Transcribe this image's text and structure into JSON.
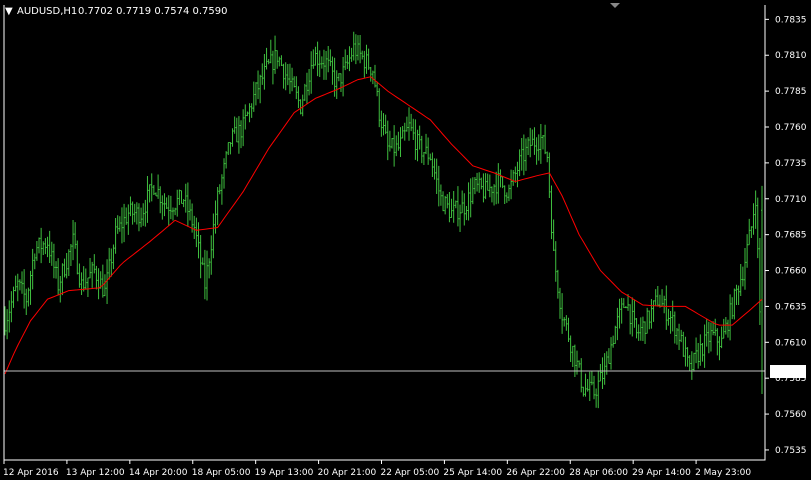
{
  "header": {
    "menu_glyph": "▼",
    "symbol_label": "AUDUSD,H1",
    "ohlc_label": "0.7702 0.7719 0.7574 0.7590"
  },
  "colors": {
    "background": "#000000",
    "frame": "#ffffff",
    "bars": "#3fbf3f",
    "moving_average": "#ff0000",
    "price_line": "#c0c0c0",
    "price_label_bg": "#ffffff",
    "price_label_text": "#000000"
  },
  "chart_data": {
    "type": "bar",
    "symbol": "AUDUSD",
    "timeframe": "H1",
    "ohlc_last": {
      "open": 0.7702,
      "high": 0.7719,
      "low": 0.7574,
      "close": 0.759
    },
    "current_price": 0.759,
    "current_price_label": "0.7590",
    "ylim": [
      0.7528,
      0.7845
    ],
    "y_ticks": [
      "0.7835",
      "0.7810",
      "0.7785",
      "0.7760",
      "0.7735",
      "0.7710",
      "0.7685",
      "0.7660",
      "0.7635",
      "0.7610",
      "0.7585",
      "0.7560",
      "0.7535"
    ],
    "x_ticks": [
      "12 Apr 2016",
      "13 Apr 12:00",
      "14 Apr 20:00",
      "18 Apr 05:00",
      "19 Apr 13:00",
      "20 Apr 21:00",
      "22 Apr 05:00",
      "25 Apr 14:00",
      "26 Apr 22:00",
      "28 Apr 06:00",
      "29 Apr 14:00",
      "2 May 23:00"
    ],
    "price_anchors": [
      [
        0,
        0.7625
      ],
      [
        6,
        0.765
      ],
      [
        10,
        0.764
      ],
      [
        14,
        0.7675
      ],
      [
        20,
        0.768
      ],
      [
        25,
        0.765
      ],
      [
        32,
        0.768
      ],
      [
        36,
        0.765
      ],
      [
        42,
        0.766
      ],
      [
        47,
        0.7645
      ],
      [
        52,
        0.7685
      ],
      [
        58,
        0.77
      ],
      [
        64,
        0.77
      ],
      [
        70,
        0.772
      ],
      [
        76,
        0.7705
      ],
      [
        84,
        0.771
      ],
      [
        89,
        0.769
      ],
      [
        94,
        0.765
      ],
      [
        100,
        0.771
      ],
      [
        106,
        0.775
      ],
      [
        112,
        0.776
      ],
      [
        118,
        0.7785
      ],
      [
        123,
        0.78
      ],
      [
        128,
        0.781
      ],
      [
        134,
        0.779
      ],
      [
        139,
        0.7775
      ],
      [
        145,
        0.781
      ],
      [
        151,
        0.7805
      ],
      [
        156,
        0.779
      ],
      [
        160,
        0.78
      ],
      [
        164,
        0.7815
      ],
      [
        170,
        0.7805
      ],
      [
        173,
        0.78
      ],
      [
        176,
        0.777
      ],
      [
        180,
        0.7745
      ],
      [
        185,
        0.7745
      ],
      [
        190,
        0.776
      ],
      [
        195,
        0.7745
      ],
      [
        200,
        0.774
      ],
      [
        205,
        0.771
      ],
      [
        210,
        0.77
      ],
      [
        216,
        0.7705
      ],
      [
        221,
        0.7718
      ],
      [
        226,
        0.7715
      ],
      [
        232,
        0.7722
      ],
      [
        237,
        0.7715
      ],
      [
        242,
        0.7735
      ],
      [
        247,
        0.7748
      ],
      [
        252,
        0.7752
      ],
      [
        255,
        0.774
      ],
      [
        258,
        0.767
      ],
      [
        262,
        0.763
      ],
      [
        267,
        0.7605
      ],
      [
        272,
        0.7578
      ],
      [
        277,
        0.7575
      ],
      [
        282,
        0.759
      ],
      [
        287,
        0.762
      ],
      [
        292,
        0.764
      ],
      [
        297,
        0.7615
      ],
      [
        302,
        0.7625
      ],
      [
        307,
        0.764
      ],
      [
        312,
        0.763
      ],
      [
        317,
        0.7615
      ],
      [
        322,
        0.759
      ],
      [
        327,
        0.7605
      ],
      [
        332,
        0.7615
      ],
      [
        337,
        0.761
      ],
      [
        342,
        0.7635
      ],
      [
        347,
        0.766
      ],
      [
        351,
        0.769
      ],
      [
        353,
        0.7712
      ],
      [
        356,
        0.759
      ]
    ],
    "ma_anchors": [
      [
        0,
        0.7588
      ],
      [
        5,
        0.7605
      ],
      [
        12,
        0.7625
      ],
      [
        20,
        0.764
      ],
      [
        30,
        0.7646
      ],
      [
        45,
        0.7648
      ],
      [
        55,
        0.7665
      ],
      [
        68,
        0.768
      ],
      [
        80,
        0.7695
      ],
      [
        90,
        0.7688
      ],
      [
        100,
        0.769
      ],
      [
        112,
        0.7715
      ],
      [
        124,
        0.7745
      ],
      [
        136,
        0.777
      ],
      [
        146,
        0.778
      ],
      [
        156,
        0.7786
      ],
      [
        166,
        0.7793
      ],
      [
        172,
        0.7795
      ],
      [
        180,
        0.7785
      ],
      [
        190,
        0.7775
      ],
      [
        200,
        0.7765
      ],
      [
        210,
        0.7748
      ],
      [
        220,
        0.7733
      ],
      [
        230,
        0.7728
      ],
      [
        240,
        0.7722
      ],
      [
        250,
        0.7726
      ],
      [
        256,
        0.7728
      ],
      [
        262,
        0.7712
      ],
      [
        270,
        0.7685
      ],
      [
        280,
        0.766
      ],
      [
        290,
        0.7645
      ],
      [
        300,
        0.7636
      ],
      [
        310,
        0.7635
      ],
      [
        320,
        0.7635
      ],
      [
        328,
        0.7628
      ],
      [
        335,
        0.7622
      ],
      [
        342,
        0.7622
      ],
      [
        350,
        0.7632
      ],
      [
        356,
        0.764
      ]
    ]
  }
}
